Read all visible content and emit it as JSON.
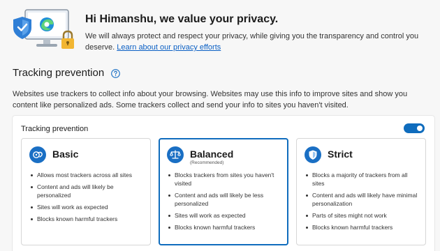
{
  "hero": {
    "title": "Hi Himanshu, we value your privacy.",
    "body": "We will always protect and respect your privacy, while giving you the transparency and control you deserve. ",
    "link": "Learn about our privacy efforts"
  },
  "tracking": {
    "section_title": "Tracking prevention",
    "description": "Websites use trackers to collect info about your browsing. Websites may use this info to improve sites and show you content like personalized ads. Some trackers collect and send your info to sites you haven't visited.",
    "panel_label": "Tracking prevention",
    "toggle_on": true,
    "accent_color": "#0f6cbd"
  },
  "cards": [
    {
      "title": "Basic",
      "subtitle": "",
      "icon": "basic-icon",
      "selected": false,
      "bullets": [
        "Allows most trackers across all sites",
        "Content and ads will likely be personalized",
        "Sites will work as expected",
        "Blocks known harmful trackers"
      ]
    },
    {
      "title": "Balanced",
      "subtitle": "(Recommended)",
      "icon": "scales-icon",
      "selected": true,
      "bullets": [
        "Blocks trackers from sites you haven't visited",
        "Content and ads will likely be less personalized",
        "Sites will work as expected",
        "Blocks known harmful trackers"
      ]
    },
    {
      "title": "Strict",
      "subtitle": "",
      "icon": "shield-icon",
      "selected": false,
      "bullets": [
        "Blocks a majority of trackers from all sites",
        "Content and ads will likely have minimal personalization",
        "Parts of sites might not work",
        "Blocks known harmful trackers"
      ]
    }
  ]
}
